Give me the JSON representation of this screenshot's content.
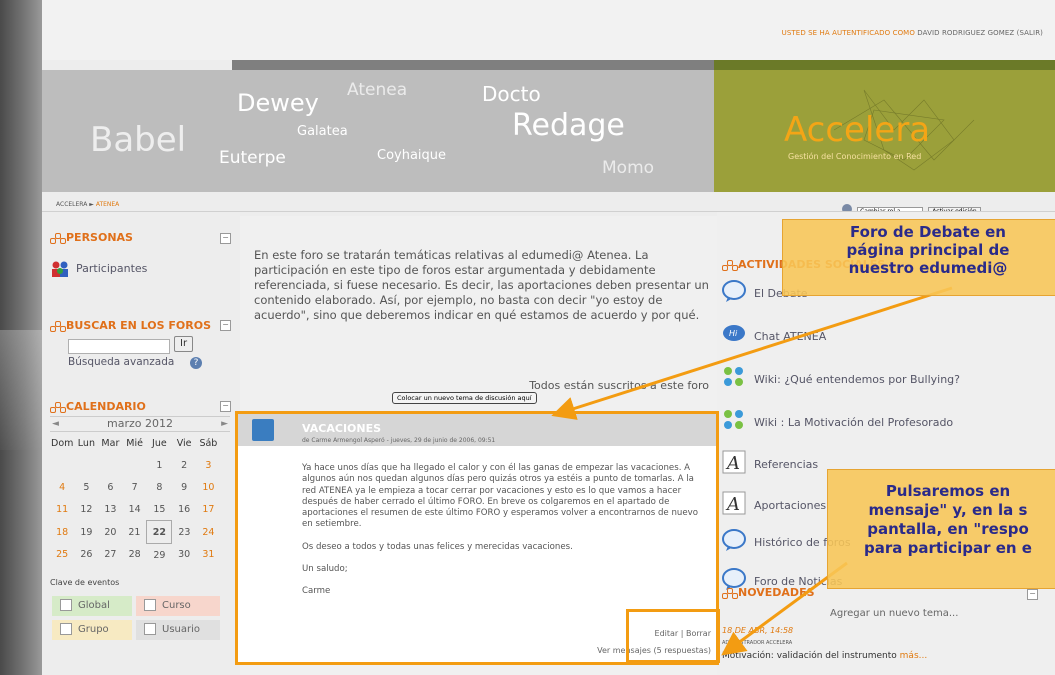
{
  "header": {
    "login_prefix": "USTED SE HA AUTENTIFICADO COMO",
    "user_name": "DAVID RODRIGUEZ GOMEZ (SALIR)"
  },
  "banner": {
    "words": [
      "Babel",
      "Dewey",
      "Atenea",
      "Docto",
      "Galatea",
      "Redage",
      "Euterpe",
      "Coyhaique",
      "Momo"
    ],
    "logo": "Accelera",
    "logo_sub": "Gestión del Conocimiento en Red"
  },
  "breadcrumb": {
    "root": "ACCELERA",
    "sep": "►",
    "current": "ATENEA"
  },
  "role": {
    "select_value": "Cambiar rol a...",
    "edit_button": "Activar edición"
  },
  "personas": {
    "title": "PERSONAS",
    "participants": "Participantes"
  },
  "search": {
    "title": "BUSCAR EN LOS FOROS",
    "button": "Ir",
    "advanced": "Búsqueda avanzada"
  },
  "calendar": {
    "title": "CALENDARIO",
    "month": "marzo 2012",
    "prev": "◄",
    "next": "►",
    "days": [
      "Dom",
      "Lun",
      "Mar",
      "Mié",
      "Jue",
      "Vie",
      "Sáb"
    ],
    "weeks": [
      [
        "",
        "",
        "",
        "",
        "1",
        "2",
        "3"
      ],
      [
        "4",
        "5",
        "6",
        "7",
        "8",
        "9",
        "10"
      ],
      [
        "11",
        "12",
        "13",
        "14",
        "15",
        "16",
        "17"
      ],
      [
        "18",
        "19",
        "20",
        "21",
        "22",
        "23",
        "24"
      ],
      [
        "25",
        "26",
        "27",
        "28",
        "29",
        "30",
        "31"
      ]
    ],
    "today": "22",
    "keys_title": "Clave de eventos",
    "keys": [
      "Global",
      "Curso",
      "Grupo",
      "Usuario"
    ]
  },
  "forum": {
    "intro": "En este foro se tratarán temáticas relativas al edumedi@ Atenea.  La participación en este tipo de foros estar argumentada y debidamente referenciada, si fuese necesario. Es decir, las aportaciones deben presentar un contenido elaborado. Así, por ejemplo, no basta con decir \"yo estoy de acuerdo\", sino que deberemos indicar en qué estamos de acuerdo y por qué.",
    "subscribed": "Todos están suscritos a este foro",
    "new_topic_button": "Colocar un nuevo tema de discusión aquí"
  },
  "post": {
    "title": "VACACIONES",
    "meta": "de Carme Armengol Asperó - jueves, 29 de junio de 2006, 09:51",
    "paragraphs": [
      "Ya hace unos días que ha llegado el calor y con él las ganas de empezar las vacaciones. A algunos aún nos quedan algunos días pero quizás otros ya estéis a punto de tomarlas. A la red ATENEA ya le empieza a tocar cerrar por vacaciones y esto es lo que vamos a hacer después de haber cerrado el último FORO. En breve os colgaremos en el apartado de aportaciones  el resumen de este último FORO y esperamos volver a encontrarnos de nuevo en setiembre.",
      "Os deseo a todos y todas unas felices y merecidas vacaciones.",
      "Un saludo;",
      "Carme"
    ],
    "actions": "Editar | Borrar",
    "replies": "Ver mensajes (5 respuestas)"
  },
  "activities": {
    "title": "ACTIVIDADES SOCIALES",
    "items": [
      {
        "label": "El Debate",
        "icon": "forum-icon"
      },
      {
        "label": "Chat ATENEA",
        "icon": "chat-icon"
      },
      {
        "label": "Wiki: ¿Qué entendemos por Bullying?",
        "icon": "wiki-icon"
      },
      {
        "label": "Wiki : La Motivación del Profesorado",
        "icon": "wiki-icon"
      },
      {
        "label": "Referencias",
        "icon": "resource-icon"
      },
      {
        "label": "Aportaciones",
        "icon": "resource-icon"
      },
      {
        "label": "Histórico de foros",
        "icon": "forum-icon"
      },
      {
        "label": "Foro de Noticias",
        "icon": "forum-icon"
      }
    ]
  },
  "news": {
    "title": "NOVEDADES",
    "add": "Agregar un nuevo tema...",
    "date": "18 DE ABR, 14:58",
    "author": "ADMINISTRADOR ACCELERA",
    "headline": "Motivación: validación del instrumento",
    "more": "más..."
  },
  "callouts": {
    "top": [
      "Foro de Debate en",
      "página principal de",
      "nuestro edumedi@"
    ],
    "bottom": [
      "Pulsaremos en",
      "mensaje\" y, en la s",
      "pantalla, en \"respo",
      "para participar en e"
    ]
  },
  "colors": {
    "accent": "#e0701a",
    "highlight": "#f39c12",
    "callout_bg": "#f8c656",
    "callout_text": "#2a2a8a",
    "olive": "#9ba03a"
  }
}
